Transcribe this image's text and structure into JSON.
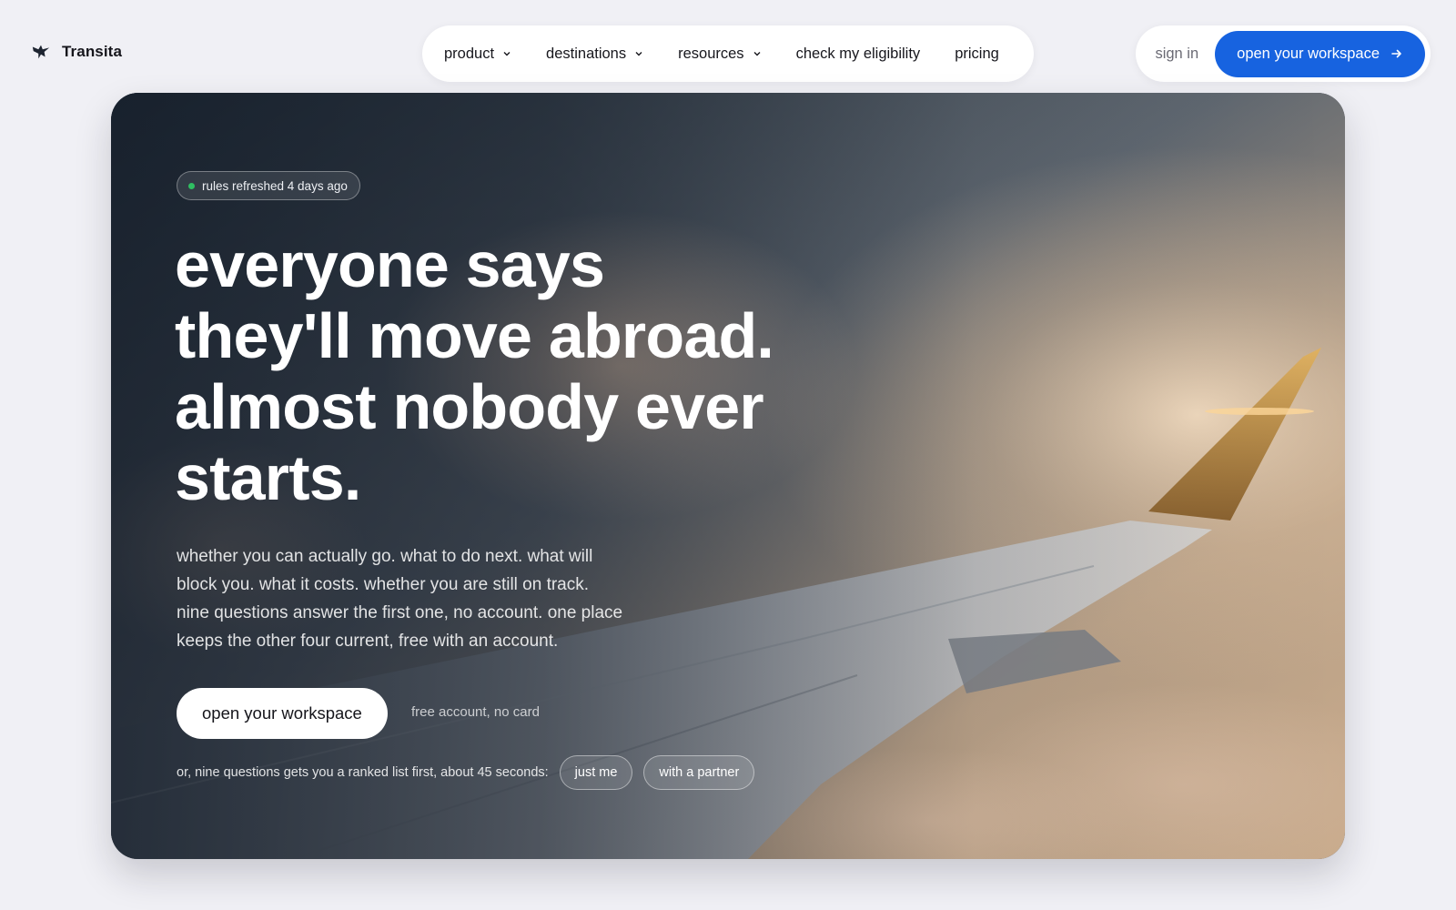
{
  "brand": {
    "name": "Transita",
    "logo_icon": "bird-logo-icon"
  },
  "nav": {
    "items": [
      {
        "label": "product",
        "has_dropdown": true
      },
      {
        "label": "destinations",
        "has_dropdown": true
      },
      {
        "label": "resources",
        "has_dropdown": true
      },
      {
        "label": "check my eligibility",
        "has_dropdown": false
      },
      {
        "label": "pricing",
        "has_dropdown": false
      }
    ]
  },
  "auth": {
    "sign_in": "sign in",
    "cta": "open your workspace",
    "cta_icon": "arrow-right-icon"
  },
  "hero": {
    "badge": "rules refreshed 4 days ago",
    "headline": [
      "everyone says",
      "they'll move abroad.",
      "almost nobody ever",
      "starts."
    ],
    "subcopy": [
      "whether you can actually go. what to do next. what will",
      "block you. what it costs. whether you are still on track.",
      "nine questions answer the first one, no account. one place",
      "keeps the other four current, free with an account."
    ],
    "cta": "open your workspace",
    "cta_note": "free account, no card",
    "quiz_label": "or, nine questions gets you a ranked list first, about 45 seconds:",
    "quiz_options": [
      "just me",
      "with a partner"
    ]
  },
  "colors": {
    "accent": "#1763e0",
    "page_bg": "#f0f0f5",
    "status_dot": "#2fbf62"
  }
}
